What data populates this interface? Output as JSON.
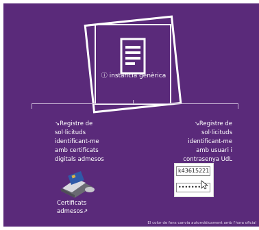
{
  "tile": {
    "caption": "ⓘ instància genèrica"
  },
  "left_option": {
    "text_lines": [
      "↘Registre de",
      "sol·licituds",
      "identificant-me",
      "amb certificats",
      "digitals admesos"
    ],
    "link_lines": [
      "Certificats",
      "admesos↗"
    ]
  },
  "right_option": {
    "text_lines": [
      "↘Registre de",
      "sol·licituds",
      "identificant-me",
      "amb usuari i",
      "contrasenya UdL"
    ],
    "username_value": "k43615221",
    "password_value": "••••••••"
  },
  "footer": {
    "note": "El color de fons canvia automàticament amb l'hora oficial"
  },
  "colors": {
    "background": "#5a2a7a",
    "line": "#c9b7d6",
    "white": "#ffffff"
  }
}
